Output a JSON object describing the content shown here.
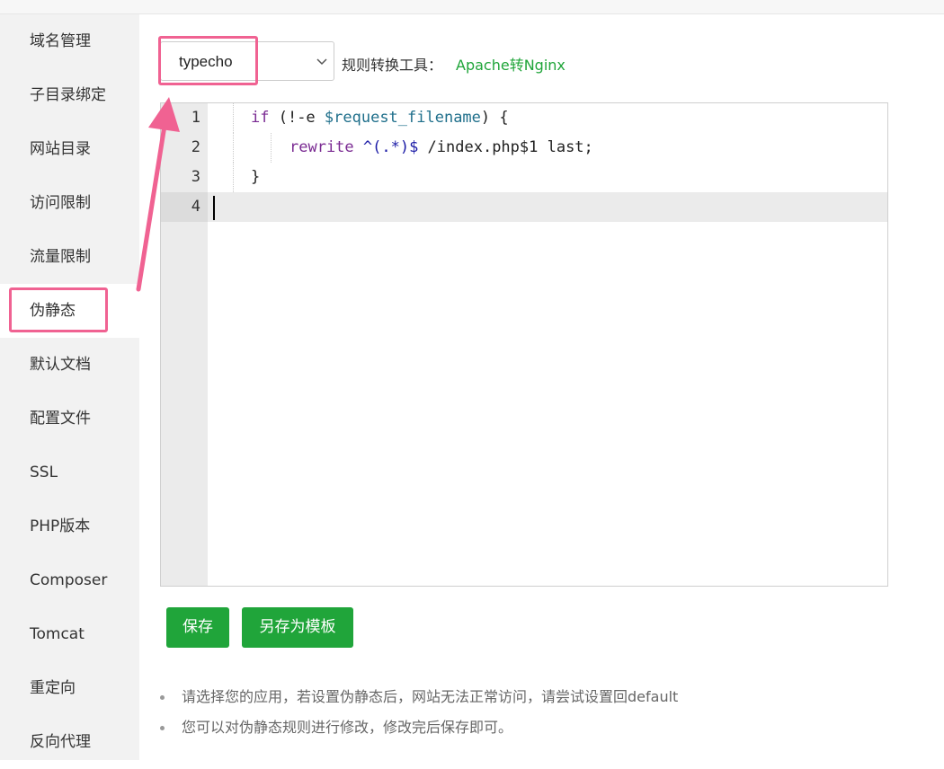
{
  "sidebar": {
    "items": [
      {
        "label": "域名管理"
      },
      {
        "label": "子目录绑定"
      },
      {
        "label": "网站目录"
      },
      {
        "label": "访问限制"
      },
      {
        "label": "流量限制"
      },
      {
        "label": "伪静态"
      },
      {
        "label": "默认文档"
      },
      {
        "label": "配置文件"
      },
      {
        "label": "SSL"
      },
      {
        "label": "PHP版本"
      },
      {
        "label": "Composer"
      },
      {
        "label": "Tomcat"
      },
      {
        "label": "重定向"
      },
      {
        "label": "反向代理"
      }
    ],
    "active_index": 5
  },
  "rewrite": {
    "select_value": "typecho",
    "tool_label": "规则转换工具：",
    "tool_link": "Apache转Nginx"
  },
  "editor": {
    "line_numbers": [
      "1",
      "2",
      "3",
      "4"
    ],
    "lines": {
      "l1_kw": "if",
      "l1_a": " (!-e ",
      "l1_var": "$request_filename",
      "l1_b": ") {",
      "l2_kw": "rewrite",
      "l2_rx": " ^(.*)$",
      "l2_b": " /index.php$1 last;",
      "l3": "}"
    }
  },
  "buttons": {
    "save": "保存",
    "save_template": "另存为模板"
  },
  "tips": [
    "请选择您的应用，若设置伪静态后，网站无法正常访问，请尝试设置回default",
    "您可以对伪静态规则进行修改，修改完后保存即可。"
  ],
  "colors": {
    "accent": "#20a53a",
    "highlight": "#f06292"
  }
}
